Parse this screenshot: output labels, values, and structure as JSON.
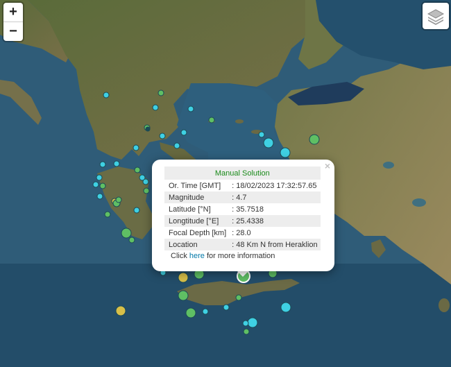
{
  "controls": {
    "zoom_in": "+",
    "zoom_out": "−",
    "layers_icon": "layers-icon"
  },
  "colors": {
    "sea": "#2c5872",
    "marker_cyan": "#3fd0e3",
    "marker_green": "#5fbf64",
    "marker_yellow": "#d8bf48",
    "popup_title": "#1a8a1a",
    "link": "#0078a8"
  },
  "popup": {
    "title": "Manual Solution",
    "close": "×",
    "rows": [
      {
        "label": "Or. Time [GMT]",
        "value": ": 18/02/2023 17:32:57.65"
      },
      {
        "label": "Magnitude",
        "value": ": 4.7"
      },
      {
        "label": "Latitude [°N]",
        "value": ": 35.7518"
      },
      {
        "label": "Longtitude [°E]",
        "value": ": 25.4338"
      },
      {
        "label": "Focal Depth [km]",
        "value": ": 28.0"
      },
      {
        "label": "Location",
        "value": ": 48 Km N from Heraklion"
      }
    ],
    "info_prefix": "Click ",
    "info_link": "here",
    "info_suffix": " for more information"
  }
}
